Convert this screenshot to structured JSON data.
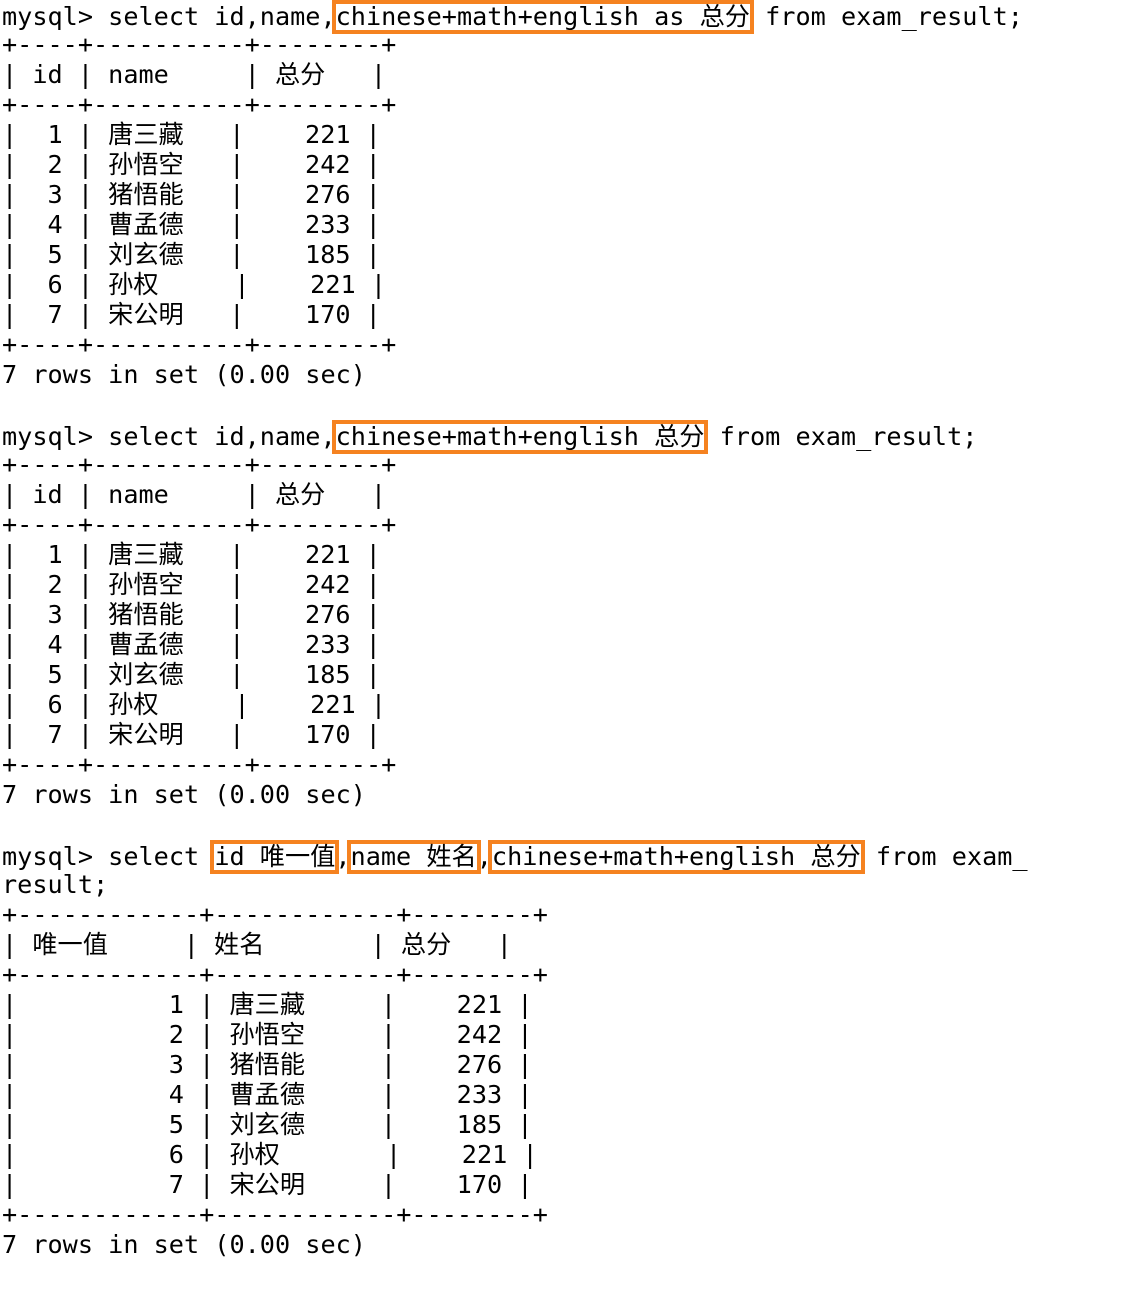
{
  "terminal": {
    "prompt": "mysql> ",
    "colors": {
      "highlight": "#F58220",
      "text": "#000000",
      "background": "#ffffff"
    },
    "blocks": [
      {
        "id": "block-1",
        "query": {
          "prompt": "mysql> ",
          "pre": "select id,name,",
          "highlight": "chinese+math+english as 总分",
          "post": " from exam_result;",
          "full": "mysql> select id,name,chinese+math+english as 总分 from exam_result;"
        },
        "table": {
          "separator": "+----+----------+--------+",
          "header": "| id | name     | 总分   |",
          "headers": [
            "id",
            "name",
            "总分"
          ],
          "rows": [
            {
              "cells": [
                "1",
                "唐三藏",
                "221"
              ],
              "text": "|  1 | 唐三藏   |    221 |"
            },
            {
              "cells": [
                "2",
                "孙悟空",
                "242"
              ],
              "text": "|  2 | 孙悟空   |    242 |"
            },
            {
              "cells": [
                "3",
                "猪悟能",
                "276"
              ],
              "text": "|  3 | 猪悟能   |    276 |"
            },
            {
              "cells": [
                "4",
                "曹孟德",
                "233"
              ],
              "text": "|  4 | 曹孟德   |    233 |"
            },
            {
              "cells": [
                "5",
                "刘玄德",
                "185"
              ],
              "text": "|  5 | 刘玄德   |    185 |"
            },
            {
              "cells": [
                "6",
                "孙权",
                "221"
              ],
              "text": "|  6 | 孙权     |    221 |"
            },
            {
              "cells": [
                "7",
                "宋公明",
                "170"
              ],
              "text": "|  7 | 宋公明   |    170 |"
            }
          ]
        },
        "status": "7 rows in set (0.00 sec)"
      },
      {
        "id": "block-2",
        "query": {
          "prompt": "mysql> ",
          "pre": "select id,name,",
          "highlight": "chinese+math+english 总分",
          "post": " from exam_result;",
          "full": "mysql> select id,name,chinese+math+english 总分 from exam_result;"
        },
        "table": {
          "separator": "+----+----------+--------+",
          "header": "| id | name     | 总分   |",
          "headers": [
            "id",
            "name",
            "总分"
          ],
          "rows": [
            {
              "cells": [
                "1",
                "唐三藏",
                "221"
              ],
              "text": "|  1 | 唐三藏   |    221 |"
            },
            {
              "cells": [
                "2",
                "孙悟空",
                "242"
              ],
              "text": "|  2 | 孙悟空   |    242 |"
            },
            {
              "cells": [
                "3",
                "猪悟能",
                "276"
              ],
              "text": "|  3 | 猪悟能   |    276 |"
            },
            {
              "cells": [
                "4",
                "曹孟德",
                "233"
              ],
              "text": "|  4 | 曹孟德   |    233 |"
            },
            {
              "cells": [
                "5",
                "刘玄德",
                "185"
              ],
              "text": "|  5 | 刘玄德   |    185 |"
            },
            {
              "cells": [
                "6",
                "孙权",
                "221"
              ],
              "text": "|  6 | 孙权     |    221 |"
            },
            {
              "cells": [
                "7",
                "宋公明",
                "170"
              ],
              "text": "|  7 | 宋公明   |    170 |"
            }
          ]
        },
        "status": "7 rows in set (0.00 sec)"
      },
      {
        "id": "block-3",
        "query": {
          "prompt": "mysql> ",
          "pre": "select ",
          "highlight1": "id 唯一值",
          "mid1": ",",
          "highlight2": "name 姓名",
          "mid2": ",",
          "highlight3": "chinese+math+english 总分",
          "post": " from exam_",
          "wrap": "result;",
          "full": "mysql> select id 唯一值,name 姓名,chinese+math+english 总分 from exam_result;"
        },
        "table": {
          "separator": "+------------+------------+--------+",
          "header": "| 唯一值     | 姓名       | 总分   |",
          "headers": [
            "唯一值",
            "姓名",
            "总分"
          ],
          "rows": [
            {
              "cells": [
                "1",
                "唐三藏",
                "221"
              ],
              "text": "|          1 | 唐三藏     |    221 |"
            },
            {
              "cells": [
                "2",
                "孙悟空",
                "242"
              ],
              "text": "|          2 | 孙悟空     |    242 |"
            },
            {
              "cells": [
                "3",
                "猪悟能",
                "276"
              ],
              "text": "|          3 | 猪悟能     |    276 |"
            },
            {
              "cells": [
                "4",
                "曹孟德",
                "233"
              ],
              "text": "|          4 | 曹孟德     |    233 |"
            },
            {
              "cells": [
                "5",
                "刘玄德",
                "185"
              ],
              "text": "|          5 | 刘玄德     |    185 |"
            },
            {
              "cells": [
                "6",
                "孙权",
                "221"
              ],
              "text": "|          6 | 孙权       |    221 |"
            },
            {
              "cells": [
                "7",
                "宋公明",
                "170"
              ],
              "text": "|          7 | 宋公明     |    170 |"
            }
          ]
        },
        "status": "7 rows in set (0.00 sec)"
      }
    ]
  }
}
